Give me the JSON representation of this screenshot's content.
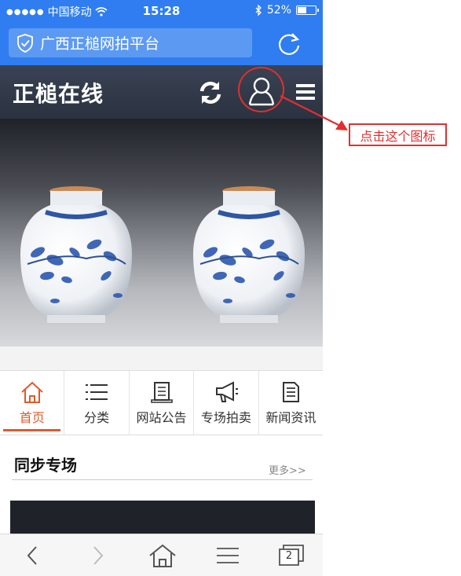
{
  "status_bar": {
    "carrier": "中国移动",
    "time": "15:28",
    "battery": "52%",
    "battery_level": 0.52
  },
  "browser": {
    "url_title": "广西正槌网拍平台",
    "tab_count": "2"
  },
  "site": {
    "logo": "正槌在线"
  },
  "annotation": {
    "label": "点击这个图标",
    "color": "#e03030"
  },
  "nav": {
    "items": [
      {
        "label": "首页",
        "icon": "home-icon",
        "active": true
      },
      {
        "label": "分类",
        "icon": "list-icon",
        "active": false
      },
      {
        "label": "网站公告",
        "icon": "notice-icon",
        "active": false
      },
      {
        "label": "专场拍卖",
        "icon": "megaphone-icon",
        "active": false
      },
      {
        "label": "新闻资讯",
        "icon": "news-icon",
        "active": false
      }
    ]
  },
  "section": {
    "title": "同步专场",
    "more": "更多>>"
  },
  "colors": {
    "browser_blue": "#2f7df0",
    "header_dark": "#333b4a",
    "accent_orange": "#e15a2b"
  }
}
